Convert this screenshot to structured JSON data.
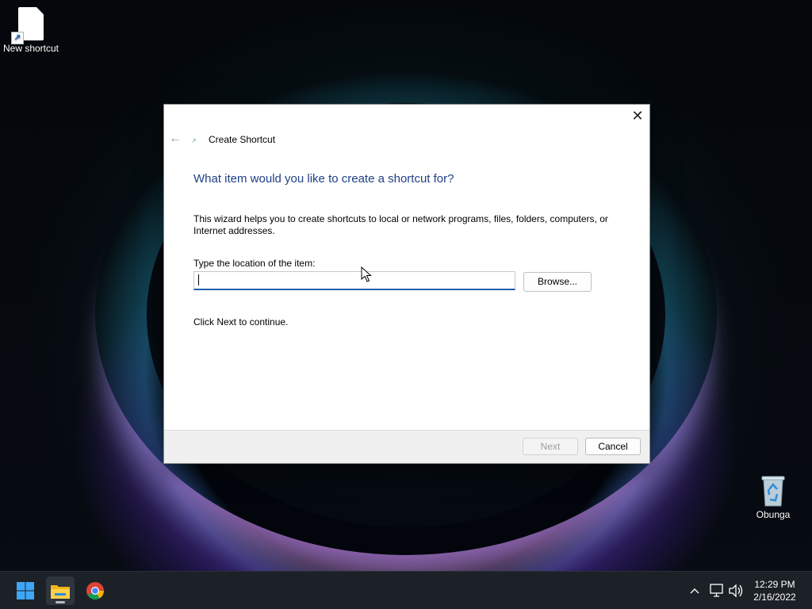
{
  "desktop": {
    "icons": [
      {
        "label": "New shortcut",
        "icon": "blank-document-shortcut-icon"
      },
      {
        "label": "Obunga",
        "icon": "recycle-bin-icon"
      }
    ]
  },
  "dialog": {
    "title": "Create Shortcut",
    "heading": "What item would you like to create a shortcut for?",
    "description": "This wizard helps you to create shortcuts to local or network programs, files, folders, computers, or Internet addresses.",
    "location_label": "Type the location of the item:",
    "location_value": "",
    "browse_label": "Browse...",
    "continue_text": "Click Next to continue.",
    "next_label": "Next",
    "cancel_label": "Cancel",
    "close_glyph": "✕",
    "back_glyph": "←"
  },
  "taskbar": {
    "apps": [
      {
        "name": "Start",
        "icon": "windows-logo-icon"
      },
      {
        "name": "File Explorer",
        "icon": "folder-icon",
        "active": true
      },
      {
        "name": "Google Chrome",
        "icon": "chrome-icon"
      }
    ],
    "tray": {
      "chevron_glyph": "^",
      "icons": [
        "network-icon",
        "volume-icon"
      ]
    },
    "time": "12:29 PM",
    "date": "2/16/2022"
  },
  "colors": {
    "heading": "#1f3f86",
    "input_focus": "#1f5ea8",
    "taskbar": "#1c2127"
  }
}
